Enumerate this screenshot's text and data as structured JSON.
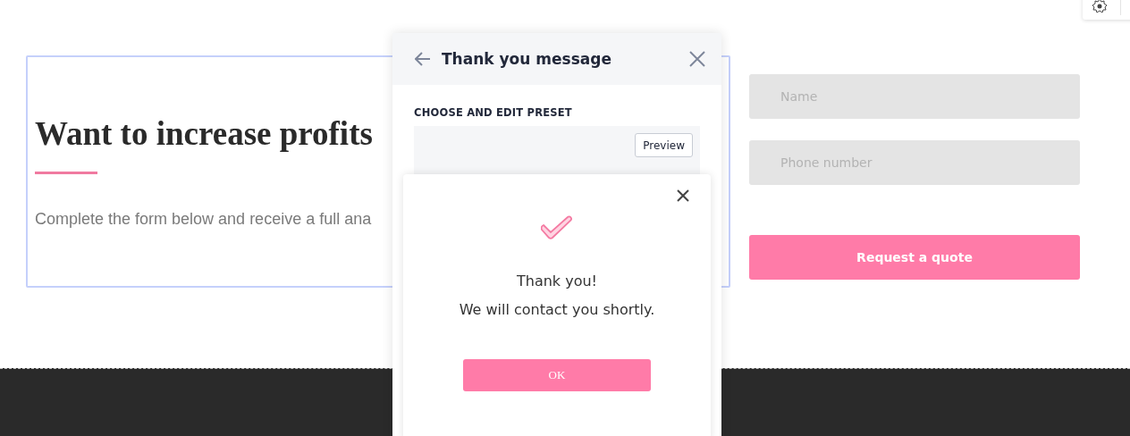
{
  "block": {
    "heading": "Want to increase profits",
    "text": "Complete the form below and receive a full ana"
  },
  "form": {
    "fields": [
      {
        "placeholder": "Name"
      },
      {
        "placeholder": "Phone number"
      }
    ],
    "submit": "Request a quote"
  },
  "panel": {
    "title": "Thank you message",
    "section_label": "CHOOSE AND EDIT PRESET",
    "preview_button": "Preview"
  },
  "popup": {
    "title": "Thank you!",
    "message": "We will contact you shortly.",
    "button": "OK"
  }
}
